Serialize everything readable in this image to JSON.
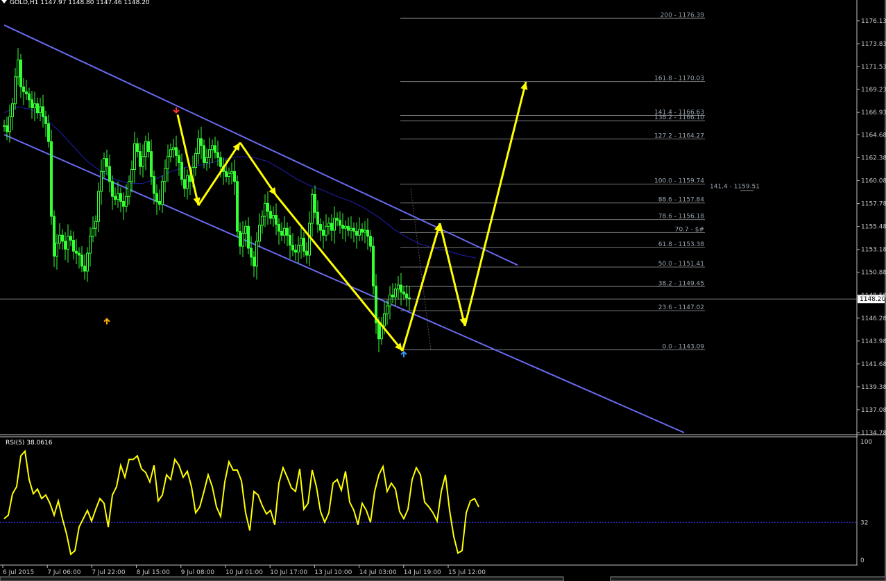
{
  "header": {
    "title": "GOLD,H1  1147.97 1148.80 1147.46 1148.20"
  },
  "colors": {
    "background": "#000000",
    "bull_candle": "#33ff33",
    "bear_candle": "#33ff33",
    "channel": "#6a6af0",
    "zigzag": "#ffff00",
    "ma": "#1a1a9a",
    "fib": "#7a7a7a",
    "rsi": "#ffff00",
    "rsi_level": "#3a3aff",
    "price_line": "#c0c0c0",
    "axis_text": "#c8c8c8"
  },
  "chart_data": [
    {
      "type": "line",
      "title": "GOLD,H1",
      "ylim": [
        1134.78,
        1177.5
      ],
      "y_ticks": [
        "1176.13",
        "1173.83",
        "1171.53",
        "1169.23",
        "1166.93",
        "1164.68",
        "1162.38",
        "1160.08",
        "1157.78",
        "1155.48",
        "1153.18",
        "1150.88",
        "1148.58",
        "1146.28",
        "1143.98",
        "1141.68",
        "1139.38",
        "1137.08",
        "1134.78"
      ],
      "x_ticks": [
        "6 Jul 2015",
        "7 Jul 06:00",
        "7 Jul 22:00",
        "8 Jul 15:00",
        "9 Jul 08:00",
        "10 Jul 01:00",
        "10 Jul 17:00",
        "13 Jul 10:00",
        "14 Jul 03:00",
        "14 Jul 19:00",
        "15 Jul 12:00"
      ],
      "current_price": "1148.20",
      "price_line_value": 1148.2,
      "ohlc": {
        "open": 1147.97,
        "high": 1148.8,
        "low": 1147.46,
        "close": 1148.2
      },
      "price_series": {
        "name": "GOLD,H1",
        "bar_index": [
          0,
          2,
          4,
          6,
          8,
          10,
          12,
          14,
          16,
          18,
          20,
          22,
          24,
          26,
          28,
          30,
          32,
          34,
          36,
          38,
          40,
          42,
          44,
          46,
          48,
          50,
          52,
          54,
          56,
          58,
          60,
          62,
          64,
          66,
          68,
          70,
          72,
          74,
          76,
          78,
          80,
          82,
          84,
          86,
          88,
          90,
          92,
          94,
          96,
          98,
          100,
          102,
          104,
          106,
          108,
          110,
          112,
          114,
          116,
          118,
          120,
          122,
          124,
          126,
          128,
          130,
          132,
          134,
          136,
          138,
          140,
          142,
          144,
          146,
          148,
          150,
          152,
          154,
          156,
          158,
          160,
          162,
          164,
          166,
          168,
          170,
          172,
          174,
          176,
          178,
          180,
          182,
          184,
          186,
          188,
          190,
          192,
          194,
          196,
          198,
          200,
          202,
          204,
          206,
          208,
          210,
          212,
          214,
          216,
          218,
          220,
          222,
          224,
          226,
          228,
          230,
          232,
          234,
          236,
          238,
          240,
          242,
          244,
          246,
          248,
          250,
          252,
          254,
          256,
          258,
          260,
          262,
          264,
          266,
          268,
          270,
          272,
          274,
          276,
          278,
          280,
          282,
          284,
          286,
          288,
          290,
          292,
          294,
          296,
          298,
          300,
          302,
          304,
          306,
          308,
          310,
          312,
          314,
          316,
          318,
          320,
          322,
          324,
          326,
          328,
          330,
          332,
          334,
          336,
          338,
          340,
          342
        ],
        "close": [
          1165.6,
          1165.0,
          1166.5,
          1167.8,
          1170.5,
          1172.2,
          1169.5,
          1169.0,
          1168.8,
          1168.2,
          1167.4,
          1167.8,
          1166.9,
          1167.5,
          1166.5,
          1165.8,
          1164.0,
          1156.5,
          1152.5,
          1153.8,
          1154.6,
          1154.0,
          1153.2,
          1154.5,
          1154.1,
          1153.0,
          1152.8,
          1152.6,
          1151.5,
          1151.0,
          1152.8,
          1154.5,
          1155.3,
          1156.0,
          1159.0,
          1161.0,
          1162.3,
          1161.5,
          1160.0,
          1158.5,
          1158.2,
          1158.8,
          1158.0,
          1157.5,
          1158.5,
          1160.0,
          1161.2,
          1163.8,
          1163.0,
          1161.5,
          1162.5,
          1164.0,
          1163.0,
          1160.5,
          1158.8,
          1158.0,
          1157.7,
          1160.0,
          1161.3,
          1162.5,
          1163.2,
          1163.4,
          1162.6,
          1161.9,
          1160.2,
          1159.3,
          1160.6,
          1160.0,
          1161.4,
          1162.8,
          1164.3,
          1163.6,
          1161.9,
          1162.4,
          1163.2,
          1163.6,
          1162.9,
          1162.4,
          1161.5,
          1161.0,
          1160.5,
          1160.8,
          1161.0,
          1160.0,
          1155.0,
          1153.5,
          1154.8,
          1155.5,
          1153.3,
          1152.4,
          1151.5,
          1154.0,
          1155.6,
          1156.5,
          1157.8,
          1157.0,
          1156.3,
          1156.6,
          1155.7,
          1155.0,
          1154.6,
          1155.3,
          1154.6,
          1153.6,
          1153.1,
          1152.9,
          1153.6,
          1154.3,
          1153.0,
          1152.6,
          1155.8,
          1158.7,
          1156.9,
          1155.7,
          1155.1,
          1154.6,
          1155.5,
          1155.8,
          1155.1,
          1156.3,
          1156.1,
          1155.6,
          1155.3,
          1155.5,
          1155.1,
          1155.3,
          1155.0,
          1154.6,
          1155.2,
          1154.9,
          1155.1,
          1154.5,
          1153.5,
          1149.5,
          1145.8,
          1144.2,
          1145.5,
          1146.7,
          1147.5,
          1148.6,
          1148.4,
          1149.2,
          1149.6,
          1148.9,
          1148.7,
          1148.3,
          1148.2
        ]
      },
      "ma_series": {
        "name": "MA",
        "bar_index": [
          0,
          10,
          20,
          30,
          40,
          50,
          60,
          70,
          80,
          90,
          100,
          110,
          120,
          130,
          140,
          150,
          160,
          170,
          180,
          190,
          200,
          210,
          220,
          230,
          240,
          250,
          260,
          270,
          280,
          290,
          300,
          310,
          320,
          330,
          340
        ],
        "values": [
          1166.9,
          1167.5,
          1167.2,
          1166.3,
          1165.0,
          1163.5,
          1162.0,
          1161.0,
          1160.2,
          1159.8,
          1159.8,
          1160.3,
          1161.0,
          1161.4,
          1161.6,
          1161.9,
          1162.3,
          1162.5,
          1162.4,
          1162.0,
          1161.2,
          1160.3,
          1159.6,
          1159.1,
          1158.5,
          1158.0,
          1157.3,
          1156.4,
          1155.3,
          1154.4,
          1153.7,
          1153.3,
          1153.0,
          1152.6,
          1152.3
        ]
      },
      "channel_lines": [
        {
          "name": "upper",
          "points": [
            [
              0,
              1175.7
            ],
            [
              370,
              1151.6
            ]
          ]
        },
        {
          "name": "lower",
          "points": [
            [
              0,
              1164.7
            ],
            [
              490,
              1134.78
            ]
          ]
        }
      ],
      "zigzag": {
        "name": "pattern",
        "points": [
          [
            125,
            1166.7
          ],
          [
            140,
            1157.6
          ],
          [
            170,
            1163.9
          ],
          [
            196,
            1158.6
          ],
          [
            287,
            1143.0
          ],
          [
            314,
            1155.8
          ],
          [
            332,
            1145.5
          ],
          [
            376,
            1170.0
          ]
        ]
      },
      "arrow_markers": [
        {
          "name": "low-marker",
          "bar": 74,
          "price": 1146.2,
          "dir": "up",
          "color": "#ffaa00"
        },
        {
          "name": "high-marker",
          "bar": 124,
          "price": 1166.9,
          "dir": "down",
          "color": "#ff3030"
        },
        {
          "name": "low-marker-2",
          "bar": 288,
          "price": 1142.9,
          "dir": "up",
          "color": "#3399ff"
        }
      ],
      "fibonacci": {
        "levels": [
          {
            "label": "200 - 1176.39",
            "price": 1176.39
          },
          {
            "label": "161.8 - 1170.03",
            "price": 1170.03
          },
          {
            "label": "141.4 - 1166.63",
            "price": 1166.63
          },
          {
            "label": "138.2 - 1166.10",
            "price": 1166.1
          },
          {
            "label": "127.2 - 1164.27",
            "price": 1164.27
          },
          {
            "label": "100.0 - 1159.74",
            "price": 1159.74
          },
          {
            "label": "88.6 - 1157.84",
            "price": 1157.84
          },
          {
            "label": "78.6 - 1156.18",
            "price": 1156.18
          },
          {
            "label": "70.7 - $#",
            "price": 1154.87
          },
          {
            "label": "61.8 - 1153.38",
            "price": 1153.38
          },
          {
            "label": "50.0 - 1151.41",
            "price": 1151.41
          },
          {
            "label": "38.2 - 1149.45",
            "price": 1149.45
          },
          {
            "label": "23.6 - 1147.02",
            "price": 1147.02
          },
          {
            "label": "0.0 - 1143.09",
            "price": 1143.09
          }
        ],
        "extra_label": {
          "label": "141.4 - 1159.51",
          "price": 1159.51
        }
      }
    },
    {
      "type": "line",
      "title": "RSI(5) 38.0616",
      "ylim": [
        0,
        100
      ],
      "y_ticks": [
        "100",
        "32",
        "0"
      ],
      "level": 32,
      "series": [
        {
          "bar_index": [
            0,
            3,
            6,
            9,
            12,
            15,
            18,
            21,
            24,
            27,
            30,
            33,
            36,
            39,
            42,
            45,
            48,
            51,
            54,
            57,
            60,
            63,
            66,
            69,
            72,
            75,
            78,
            81,
            84,
            87,
            90,
            93,
            96,
            99,
            102,
            105,
            108,
            111,
            114,
            117,
            120,
            123,
            126,
            129,
            132,
            135,
            138,
            141,
            144,
            147,
            150,
            153,
            156,
            159,
            162,
            165,
            168,
            171,
            174,
            177,
            180,
            183,
            186,
            189,
            192,
            195,
            198,
            201,
            204,
            207,
            210,
            213,
            216,
            219,
            222,
            225,
            228,
            231,
            234,
            237,
            240,
            243,
            246,
            249,
            252,
            255,
            258,
            261,
            264,
            267,
            270,
            273,
            276,
            279,
            282,
            285,
            288,
            291,
            294,
            297,
            300,
            303,
            306,
            309,
            312,
            315,
            318,
            321,
            324,
            327,
            330,
            333,
            336,
            339,
            342
          ],
          "values": [
            35,
            38,
            56,
            62,
            88,
            92,
            68,
            56,
            60,
            52,
            55,
            48,
            38,
            50,
            35,
            22,
            5,
            8,
            28,
            35,
            42,
            33,
            43,
            52,
            48,
            28,
            55,
            62,
            80,
            70,
            85,
            85,
            88,
            77,
            74,
            66,
            80,
            50,
            55,
            72,
            68,
            85,
            80,
            70,
            75,
            62,
            40,
            45,
            58,
            72,
            62,
            45,
            37,
            66,
            83,
            76,
            76,
            67,
            40,
            25,
            58,
            55,
            46,
            39,
            42,
            30,
            65,
            78,
            70,
            61,
            58,
            77,
            43,
            48,
            76,
            62,
            41,
            32,
            40,
            65,
            68,
            59,
            75,
            49,
            42,
            30,
            48,
            42,
            32,
            58,
            72,
            79,
            58,
            65,
            60,
            41,
            35,
            43,
            68,
            78,
            72,
            49,
            45,
            40,
            33,
            58,
            72,
            42,
            20,
            6,
            8,
            40,
            50,
            52,
            45
          ]
        }
      ]
    }
  ]
}
